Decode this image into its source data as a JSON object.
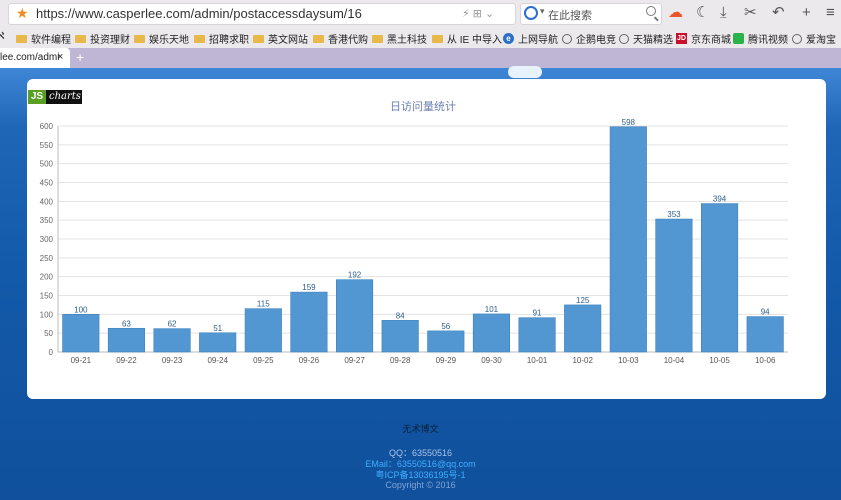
{
  "browser": {
    "url": "https://www.casperlee.com/admin/postaccessdaysum/16",
    "search_placeholder": "在此搜索",
    "bookmarks": [
      {
        "label": "软件编程",
        "icon": "folder-icon"
      },
      {
        "label": "投资理财",
        "icon": "folder-icon"
      },
      {
        "label": "娱乐天地",
        "icon": "folder-icon"
      },
      {
        "label": "招聘求职",
        "icon": "folder-icon"
      },
      {
        "label": "英文网站",
        "icon": "folder-icon"
      },
      {
        "label": "香港代购",
        "icon": "folder-icon"
      },
      {
        "label": "黑土科技",
        "icon": "folder-icon"
      },
      {
        "label": "从 IE 中导入",
        "icon": "folder-icon"
      },
      {
        "label": "上网导航",
        "icon": "e-icon"
      },
      {
        "label": "企鹅电竞",
        "icon": "globe-icon"
      },
      {
        "label": "天猫精选",
        "icon": "globe-icon"
      },
      {
        "label": "京东商城",
        "icon": "jd-icon"
      },
      {
        "label": "腾讯视频",
        "icon": "tx-icon"
      },
      {
        "label": "爱淘宝",
        "icon": "globe-icon"
      }
    ],
    "tab_title": "lee.com/admi",
    "tab_close": "×",
    "new_tab": "+",
    "jd_badge": "JD",
    "e_badge": "e"
  },
  "logo": {
    "js": "JS",
    "charts": "charts"
  },
  "chart_data": {
    "type": "bar",
    "title": "日访问量统计",
    "categories": [
      "09-21",
      "09-22",
      "09-23",
      "09-24",
      "09-25",
      "09-26",
      "09-27",
      "09-28",
      "09-29",
      "09-30",
      "10-01",
      "10-02",
      "10-03",
      "10-04",
      "10-05",
      "10-06"
    ],
    "values": [
      100,
      63,
      62,
      51,
      115,
      159,
      192,
      84,
      56,
      101,
      91,
      125,
      598,
      353,
      394,
      94
    ],
    "ylim": [
      0,
      600
    ],
    "yticks": [
      0,
      50,
      100,
      150,
      200,
      250,
      300,
      350,
      400,
      450,
      500,
      550,
      600
    ],
    "grid": true,
    "bar_color": "#5297d2",
    "label_color": "#2e5f8a"
  },
  "footer": {
    "title": "无术博文",
    "qq": "QQ：63550516",
    "email": "EMail：63550516@qq.com",
    "icp": "粤ICP备13036195号-1",
    "copyright": "Copyright © 2016"
  }
}
